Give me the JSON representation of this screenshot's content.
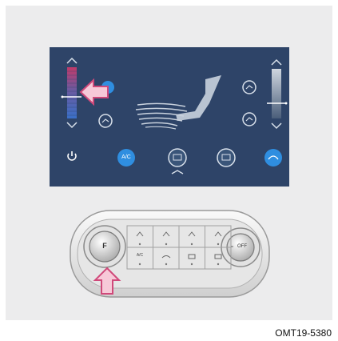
{
  "figure_code": "OMT19-5380",
  "screen": {
    "power_icon": "power-icon",
    "ac_label": "A/C",
    "buttons": [
      "A/C",
      "front-defrost-icon",
      "rear-defrost-icon",
      "recirculation-icon"
    ],
    "temperature_left_level": 0.5,
    "temperature_right_level": 0.5
  },
  "panel": {
    "left_knob_label": "F",
    "right_knob_label": "OFF",
    "top_buttons": [
      "mode-face-icon",
      "mode-bilevel-icon",
      "mode-floor-icon",
      "mode-floor-defrost-icon"
    ],
    "bottom_buttons": [
      "A/C",
      "recirculation-icon",
      "front-defrost-icon",
      "rear-defrost-icon"
    ]
  },
  "colors": {
    "screen_bg": "#2e4468",
    "accent_blue": "#2f8ee0",
    "arrow_pink": "#f7c9d8",
    "arrow_outline": "#d0497a"
  }
}
